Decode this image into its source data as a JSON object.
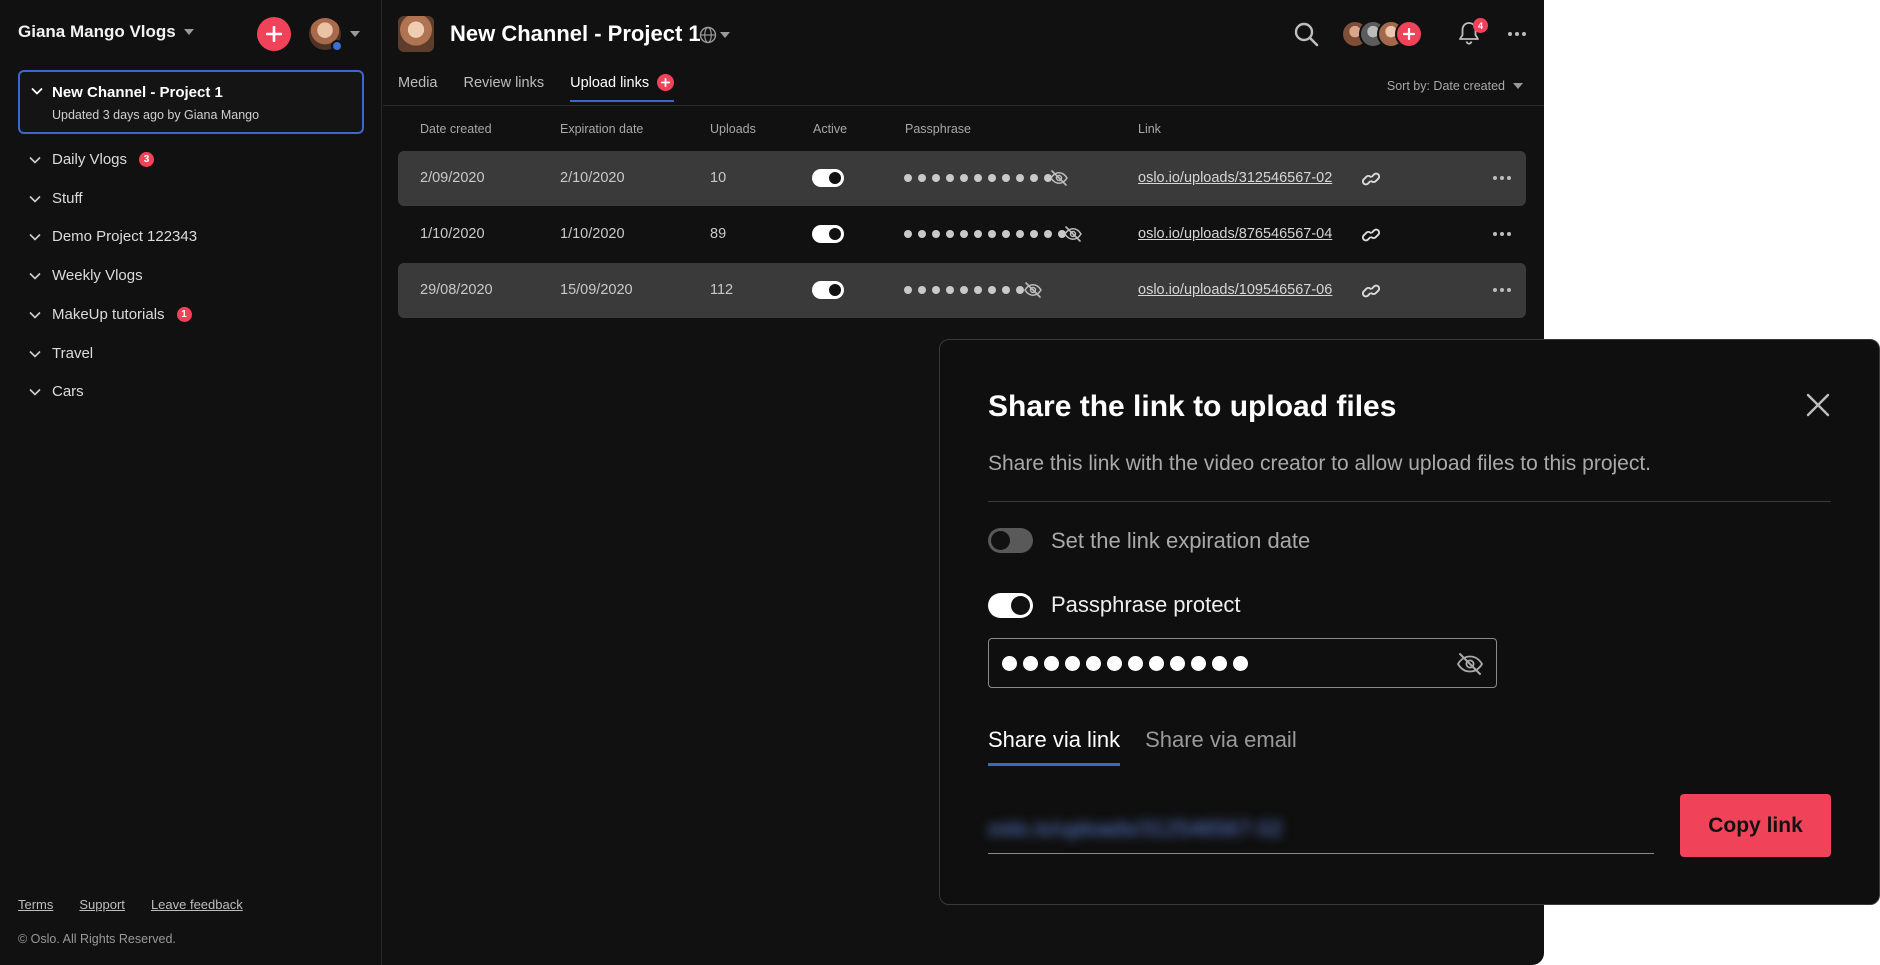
{
  "sidebar": {
    "workspace_title": "Giana Mango Vlogs",
    "current_project": {
      "name": "New Channel - Project 1",
      "meta": "Updated 3 days ago by Giana Mango"
    },
    "folders": [
      {
        "label": "Daily Vlogs",
        "badge": "3"
      },
      {
        "label": "Stuff",
        "badge": ""
      },
      {
        "label": "Demo Project 122343",
        "badge": ""
      },
      {
        "label": "Weekly Vlogs",
        "badge": ""
      },
      {
        "label": "MakeUp tutorials",
        "badge": "1"
      },
      {
        "label": "Travel",
        "badge": ""
      },
      {
        "label": "Cars",
        "badge": ""
      }
    ],
    "footer": {
      "terms": "Terms",
      "support": "Support",
      "feedback": "Leave feedback",
      "copyright": "© Oslo. All Rights Reserved."
    }
  },
  "header": {
    "project_title": "New Channel - Project 1",
    "notification_count": "4"
  },
  "tabs": {
    "media": "Media",
    "review_links": "Review links",
    "upload_links": "Upload links",
    "active": "Upload links"
  },
  "sort": {
    "label": "Sort by: Date created"
  },
  "table": {
    "columns": {
      "date_created": "Date created",
      "expiration_date": "Expiration date",
      "uploads": "Uploads",
      "active": "Active",
      "passphrase": "Passphrase",
      "link": "Link"
    },
    "rows": [
      {
        "date_created": "2/09/2020",
        "expiration_date": "2/10/2020",
        "uploads": "10",
        "active": true,
        "passphrase_length": 11,
        "link": "oslo.io/uploads/312546567-02"
      },
      {
        "date_created": "1/10/2020",
        "expiration_date": "1/10/2020",
        "uploads": "89",
        "active": true,
        "passphrase_length": 12,
        "link": "oslo.io/uploads/876546567-04"
      },
      {
        "date_created": "29/08/2020",
        "expiration_date": "15/09/2020",
        "uploads": "112",
        "active": true,
        "passphrase_length": 9,
        "link": "oslo.io/uploads/109546567-06"
      }
    ]
  },
  "modal": {
    "title": "Share the link to upload files",
    "subtitle": "Share this link with the video creator to allow upload files to this project.",
    "expiration_toggle": {
      "label": "Set the link expiration date",
      "on": false
    },
    "passphrase_toggle": {
      "label": "Passphrase protect",
      "on": true
    },
    "passphrase_length": 12,
    "share_tabs": {
      "via_link": "Share via link",
      "via_email": "Share via email",
      "active": "Share via link"
    },
    "link_value": "oslo.io/uploads/312546567-02",
    "copy_button": "Copy link"
  },
  "colors": {
    "accent": "#f0435a",
    "focus_blue": "#3d67c8",
    "background": "#111111"
  }
}
